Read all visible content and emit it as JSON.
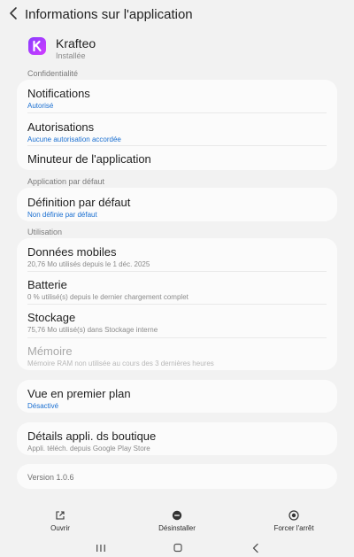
{
  "header": {
    "title": "Informations sur l'application"
  },
  "app": {
    "name": "Krafteo",
    "status": "Installée"
  },
  "sections": {
    "privacy": "Confidentialité",
    "default_app": "Application par défaut",
    "usage": "Utilisation"
  },
  "privacy": {
    "notifications": {
      "label": "Notifications",
      "value": "Autorisé"
    },
    "permissions": {
      "label": "Autorisations",
      "value": "Aucune autorisation accordée"
    },
    "timer": {
      "label": "Minuteur de l'application"
    }
  },
  "defaults": {
    "label": "Définition par défaut",
    "value": "Non définie par défaut"
  },
  "usage": {
    "mobile_data": {
      "label": "Données mobiles",
      "value": "20,76 Mo utilisés depuis le 1 déc. 2025"
    },
    "battery": {
      "label": "Batterie",
      "value": "0 % utilisé(s) depuis le dernier chargement complet"
    },
    "storage": {
      "label": "Stockage",
      "value": "75,76 Mo utilisé(s) dans Stockage interne"
    },
    "memory": {
      "label": "Mémoire",
      "value": "Mémoire RAM non utilisée au cours des 3 dernières heures"
    }
  },
  "foreground": {
    "label": "Vue en premier plan",
    "value": "Désactivé"
  },
  "store": {
    "label": "Détails appli. ds boutique",
    "value": "Appli. téléch. depuis Google Play Store"
  },
  "version": "Version 1.0.6",
  "actions": {
    "open": "Ouvrir",
    "uninstall": "Désinstaller",
    "force_stop": "Forcer l'arrêt"
  },
  "colors": {
    "accent": "#1a6fd1",
    "app_icon": "#a13cff",
    "background": "#f2f2f2"
  }
}
